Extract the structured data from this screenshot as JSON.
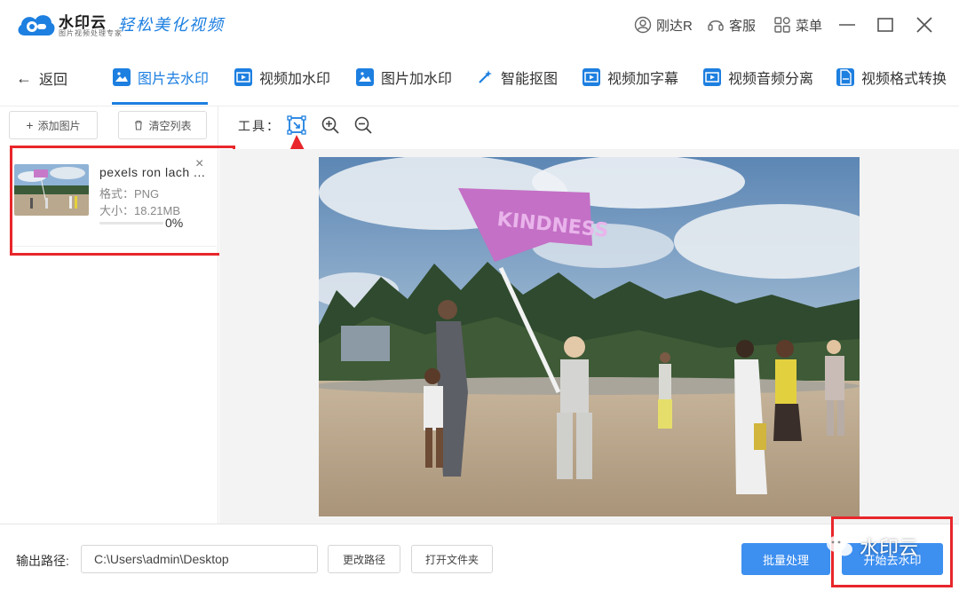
{
  "app": {
    "brand": "水印云",
    "brand_sub": "图片视频处理专家",
    "slogan": "轻松美化视频"
  },
  "titlebar": {
    "user": "刚达R",
    "service": "客服",
    "menu": "菜单"
  },
  "nav": {
    "back": "返回",
    "tabs": [
      {
        "label": "图片去水印",
        "active": true
      },
      {
        "label": "视频加水印"
      },
      {
        "label": "图片加水印"
      },
      {
        "label": "智能抠图"
      },
      {
        "label": "视频加字幕"
      },
      {
        "label": "视频音频分离"
      },
      {
        "label": "视频格式转换"
      }
    ]
  },
  "leftpanel": {
    "add_image": "添加图片",
    "clear_list": "清空列表",
    "file": {
      "name": "pexels ron lach ...",
      "format": "格式：PNG",
      "size": "大小：18.21MB",
      "progress_pct": 0,
      "progress_text": "0%"
    }
  },
  "tools": {
    "label": "工具："
  },
  "photo": {
    "flag_text": "KINDNESS"
  },
  "bottom": {
    "output_label": "输出路径:",
    "output_path": "C:\\Users\\admin\\Desktop",
    "change_path": "更改路径",
    "open_folder": "打开文件夹",
    "batch_process": "批量处理",
    "start_remove": "开始去水印"
  },
  "watermark": {
    "text": "水印云"
  },
  "colors": {
    "accent": "#1d7fe0",
    "primary_button": "#3d8ff0",
    "highlight_red": "#e8262b"
  }
}
